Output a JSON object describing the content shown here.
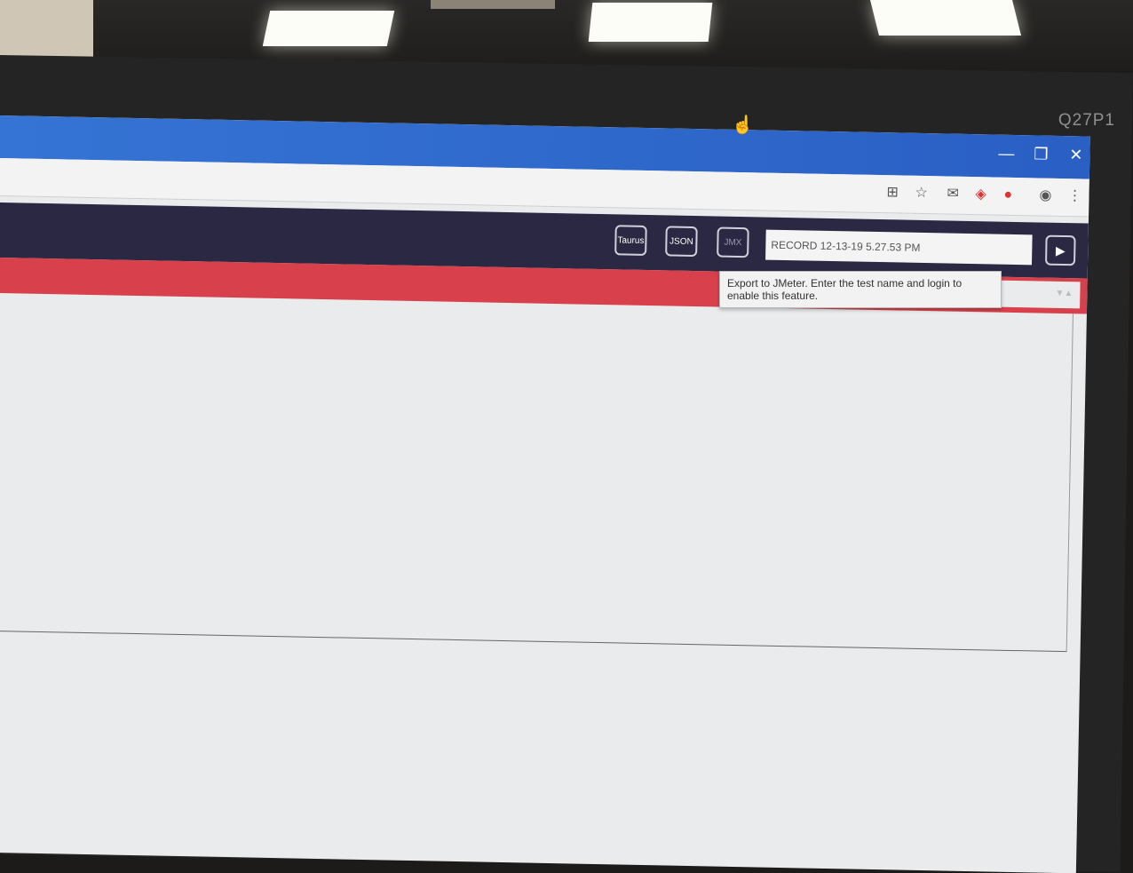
{
  "monitor": {
    "model": "Q27P1"
  },
  "window": {
    "minimize": "—",
    "restore": "❐",
    "close": "✕"
  },
  "toolbar": {
    "icons": [
      "translate-icon",
      "star-icon",
      "gmail-icon",
      "extension-icon",
      "record-extension-icon",
      "account-icon",
      "menu-icon"
    ]
  },
  "app": {
    "buttons": {
      "taurus": "Taurus",
      "json": "JSON",
      "jmx": "JMX"
    },
    "test_name": "RECORD 12-13-19 5.27.53 PM",
    "play": "▶"
  },
  "tooltip": {
    "text": "Export to JMeter. Enter the test name and login to enable this feature."
  }
}
